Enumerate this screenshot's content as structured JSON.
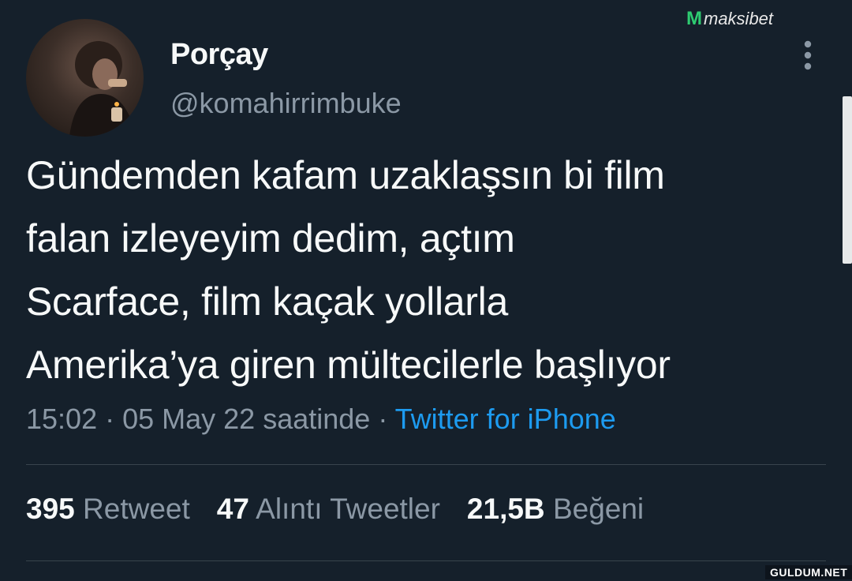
{
  "author": {
    "display_name": "Porçay",
    "handle": "@komahirrimbuke"
  },
  "watermark": {
    "logo_mark": "M",
    "logo_text": "maksibet"
  },
  "tweet": {
    "lines": [
      "Gündemden kafam uzaklaşsın bi film",
      "falan izleyeyim dedim, açtım",
      "Scarface, film kaçak yollarla",
      "Amerika’ya giren mültecilerle başlıyor"
    ],
    "time": "15:02",
    "separator": " · ",
    "date": "05 May 22 saatinde",
    "source": "Twitter for iPhone"
  },
  "stats": {
    "retweets": {
      "count": "395",
      "label": "Retweet"
    },
    "quotes": {
      "count": "47",
      "label": "Alıntı Tweetler"
    },
    "likes": {
      "count": "21,5B",
      "label": "Beğeni"
    }
  },
  "corner_tag": "GULDUM.NET",
  "colors": {
    "background": "#15202b",
    "text": "#f7f9f9",
    "secondary_text": "#8b98a5",
    "link": "#1d9bf0",
    "divider": "#38444d"
  },
  "icons": {
    "more": "more-vertical-icon",
    "avatar": "user-avatar"
  }
}
